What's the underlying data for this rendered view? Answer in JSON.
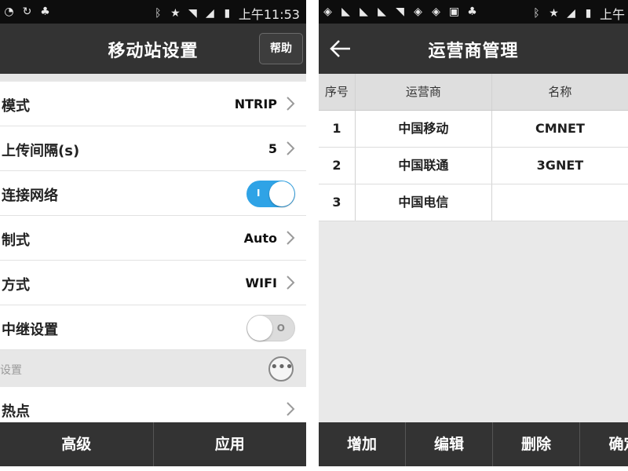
{
  "left_screen": {
    "status": {
      "clock": "上午11:53"
    },
    "title": "移动站设置",
    "help_label": "帮助",
    "rows": [
      {
        "label": "模式",
        "value": "NTRIP",
        "kind": "chevron"
      },
      {
        "label": "上传间隔(s)",
        "value": "5",
        "kind": "chevron"
      },
      {
        "label": "连接网络",
        "kind": "toggle",
        "on": true,
        "mark": "I"
      },
      {
        "label": "制式",
        "value": "Auto",
        "kind": "chevron"
      },
      {
        "label": "方式",
        "value": "WIFI",
        "kind": "chevron"
      },
      {
        "label": "中继设置",
        "kind": "toggle",
        "on": false,
        "mark": "O"
      }
    ],
    "section": {
      "label": "设置"
    },
    "last_row": {
      "label": "热点"
    },
    "bottom_buttons": [
      "高级",
      "应用"
    ]
  },
  "right_screen": {
    "status": {
      "clock": "上午"
    },
    "title": "运营商管理",
    "table": {
      "headers": [
        "序号",
        "运营商",
        "名称"
      ],
      "rows": [
        [
          "1",
          "中国移动",
          "CMNET"
        ],
        [
          "2",
          "中国联通",
          "3GNET"
        ],
        [
          "3",
          "中国电信",
          ""
        ]
      ]
    },
    "bottom_buttons": [
      "增加",
      "编辑",
      "删除",
      "确定"
    ]
  },
  "colors": {
    "bar_dark": "#333333",
    "status_black": "#0d0d0d",
    "toggle_blue": "#2fa3e6"
  }
}
